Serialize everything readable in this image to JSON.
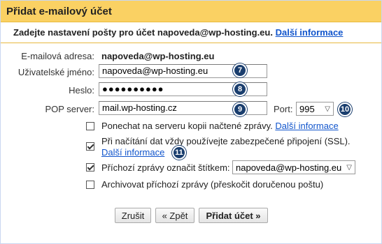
{
  "title": "Přidat e-mailový účet",
  "intro": {
    "text": "Zadejte nastavení pošty pro účet napoveda@wp-hosting.eu.",
    "link": "Další informace"
  },
  "email": {
    "label": "E-mailová adresa:",
    "value": "napoveda@wp-hosting.eu"
  },
  "username": {
    "label": "Uživatelské jméno:",
    "value": "napoveda@wp-hosting.eu",
    "badge": "7"
  },
  "password": {
    "label": "Heslo:",
    "value": "●●●●●●●●●●",
    "badge": "8"
  },
  "pop": {
    "label": "POP server:",
    "value": "mail.wp-hosting.cz",
    "badge": "9",
    "port_label": "Port:",
    "port_value": "995",
    "port_badge": "10"
  },
  "options": {
    "leave_copy": {
      "label": "Ponechat na serveru kopii načtené zprávy.",
      "link": "Další informace",
      "checked": false
    },
    "ssl": {
      "label": "Při načítání dat vždy používejte zabezpečené připojení (SSL).",
      "link": "Další informace",
      "checked": true,
      "badge": "11"
    },
    "tag": {
      "label": "Příchozí zprávy označit štítkem:",
      "select_value": "napoveda@wp-hosting.eu",
      "checked": true
    },
    "archive": {
      "label": "Archivovat příchozí zprávy (přeskočit doručenou poštu)",
      "checked": false
    }
  },
  "buttons": {
    "cancel": "Zrušit",
    "back": "« Zpět",
    "add": "Přidat účet »"
  },
  "colors": {
    "title_bg": "#fad163",
    "badge": "#1a3e6e",
    "link": "#1155cc"
  },
  "icons": {
    "checkbox_checked": "check-icon",
    "select": "chevron-down-icon"
  }
}
